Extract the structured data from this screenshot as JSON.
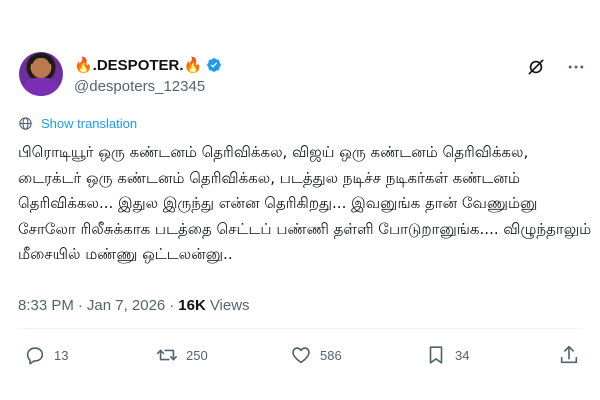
{
  "author": {
    "display_name": "🔥.DESPOTER.🔥",
    "handle": "@despoters_12345",
    "verified": true
  },
  "translate_label": "Show translation",
  "tweet_text": "பிரொடியூர் ஒரு கண்டனம் தெரிவிக்கல, விஜய் ஒரு கண்டனம் தெரிவிக்கல, டைரக்டர் ஒரு கண்டனம் தெரிவிக்கல, படத்துல நடிச்ச நடிகர்கள் கண்டனம் தெரிவிக்கல... இதுல இருந்து என்ன தெரிகிறது... இவனுங்க தான் வேணும்னு சோலோ ரிலீசுக்காக படத்தை செட்டப் பண்ணி தள்ளி போடுறானுங்க.... விழுந்தாலும் மீசையில் மண்ணு ஒட்டலன்னு..",
  "meta": {
    "time": "8:33 PM",
    "separator1": "·",
    "date": "Jan 7, 2026",
    "separator2": "·",
    "views_count": "16K",
    "views_label": "Views"
  },
  "actions": {
    "replies": "13",
    "reposts": "250",
    "likes": "586",
    "bookmarks": "34"
  },
  "icons": [
    "verified-icon",
    "grok-icon",
    "more-icon",
    "globe-icon",
    "reply-icon",
    "repost-icon",
    "like-icon",
    "bookmark-icon",
    "share-icon"
  ],
  "colors": {
    "accent": "#1d9bf0",
    "secondary_text": "#536471",
    "primary_text": "#0f1419"
  }
}
